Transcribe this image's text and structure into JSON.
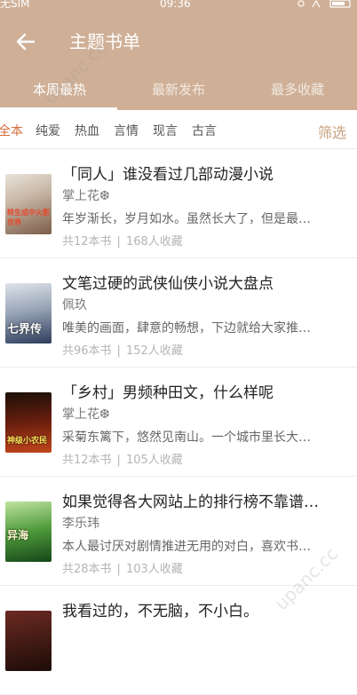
{
  "status_bar": {
    "carrier": "无SIM",
    "time": "09:36"
  },
  "header": {
    "title": "主题书单"
  },
  "tabs": [
    {
      "label": "本周最热",
      "active": true
    },
    {
      "label": "最新发布",
      "active": false
    },
    {
      "label": "最多收藏",
      "active": false
    }
  ],
  "categories": [
    {
      "label": "全本",
      "active": true
    },
    {
      "label": "纯爱",
      "active": false
    },
    {
      "label": "热血",
      "active": false
    },
    {
      "label": "言情",
      "active": false
    },
    {
      "label": "现言",
      "active": false
    },
    {
      "label": "古言",
      "active": false
    }
  ],
  "filter_label": "筛选",
  "colors": {
    "header": "#cfb097",
    "active_category": "#d66b3b",
    "filter": "#c9a07e"
  },
  "items": [
    {
      "title": "「同人」谁没看过几部动漫小说",
      "author": "掌上花❆",
      "desc": "年岁渐长，岁月如水。虽然长大了，但是最…",
      "books": "共12本书",
      "favs": "168人收藏",
      "cover_text": "转生成中火影世界"
    },
    {
      "title": "文笔过硬的武侠仙侠小说大盘点",
      "author": "佩玖",
      "desc": "唯美的画面，肆意的畅想，下边就给大家推…",
      "books": "共96本书",
      "favs": "152人收藏",
      "cover_text": "七界传"
    },
    {
      "title": "「乡村」男频种田文，什么样呢",
      "author": "掌上花❆",
      "desc": "采菊东篱下，悠然见南山。一个城市里长大…",
      "books": "共12本书",
      "favs": "105人收藏",
      "cover_text": "神级小农民"
    },
    {
      "title": "如果觉得各大网站上的排行榜不靠谱…",
      "author": "李乐玮",
      "desc": "本人最讨厌对剧情推进无用的对白，喜欢书…",
      "books": "共28本书",
      "favs": "103人收藏",
      "cover_text": "异海"
    },
    {
      "title": "我看过的，不无脑，不小白。",
      "author": "",
      "desc": "",
      "books": "",
      "favs": "",
      "cover_text": ""
    }
  ],
  "watermark": "upanc.cc"
}
